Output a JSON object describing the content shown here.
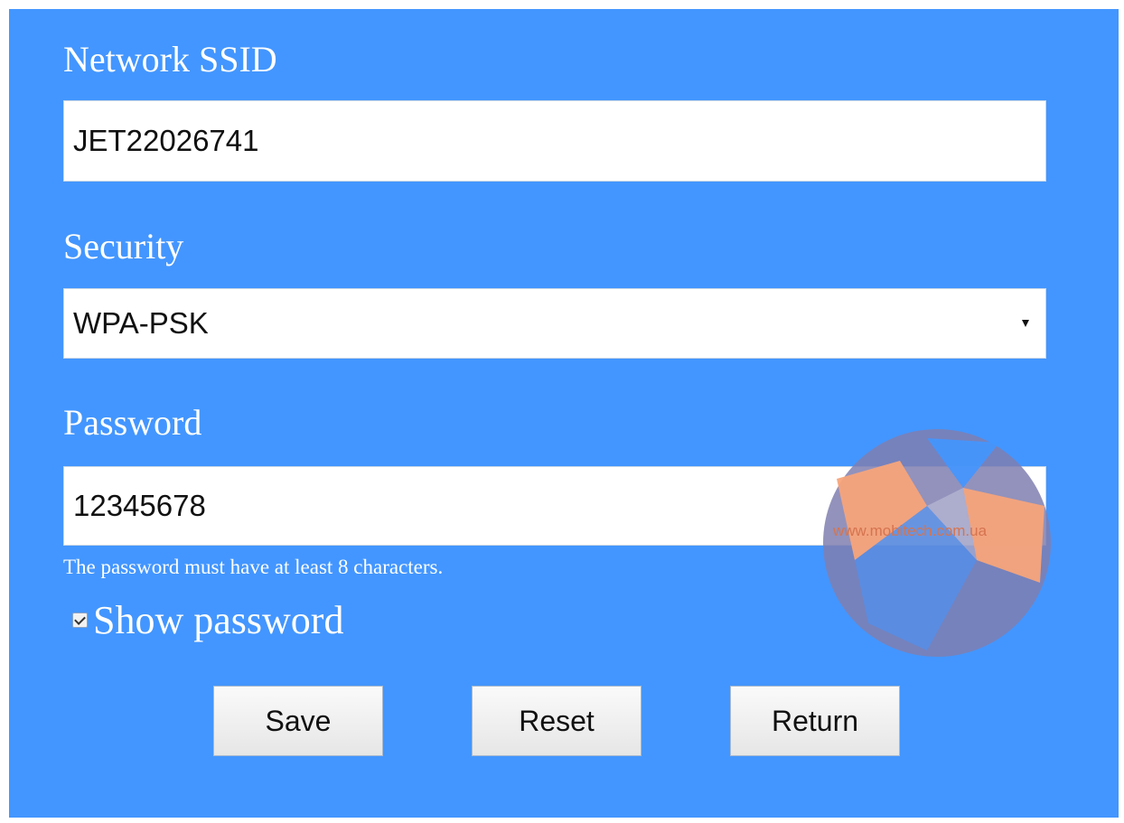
{
  "form": {
    "ssid_label": "Network SSID",
    "ssid_value": "JET22026741",
    "security_label": "Security",
    "security_value": "WPA-PSK",
    "password_label": "Password",
    "password_value": "12345678",
    "password_hint": "The password must have at least 8 characters.",
    "show_password_label": "Show password",
    "show_password_checked": true
  },
  "buttons": {
    "save": "Save",
    "reset": "Reset",
    "return": "Return"
  },
  "watermark": {
    "text": "www.mobitech.com.ua"
  },
  "colors": {
    "background": "#4396ff",
    "label_text": "#ffffff",
    "watermark_orange": "#f7a47a",
    "watermark_purple": "#7f7fb0"
  },
  "icons": {
    "select_arrow": "chevron-down-icon",
    "checkbox": "checkmark-icon"
  }
}
